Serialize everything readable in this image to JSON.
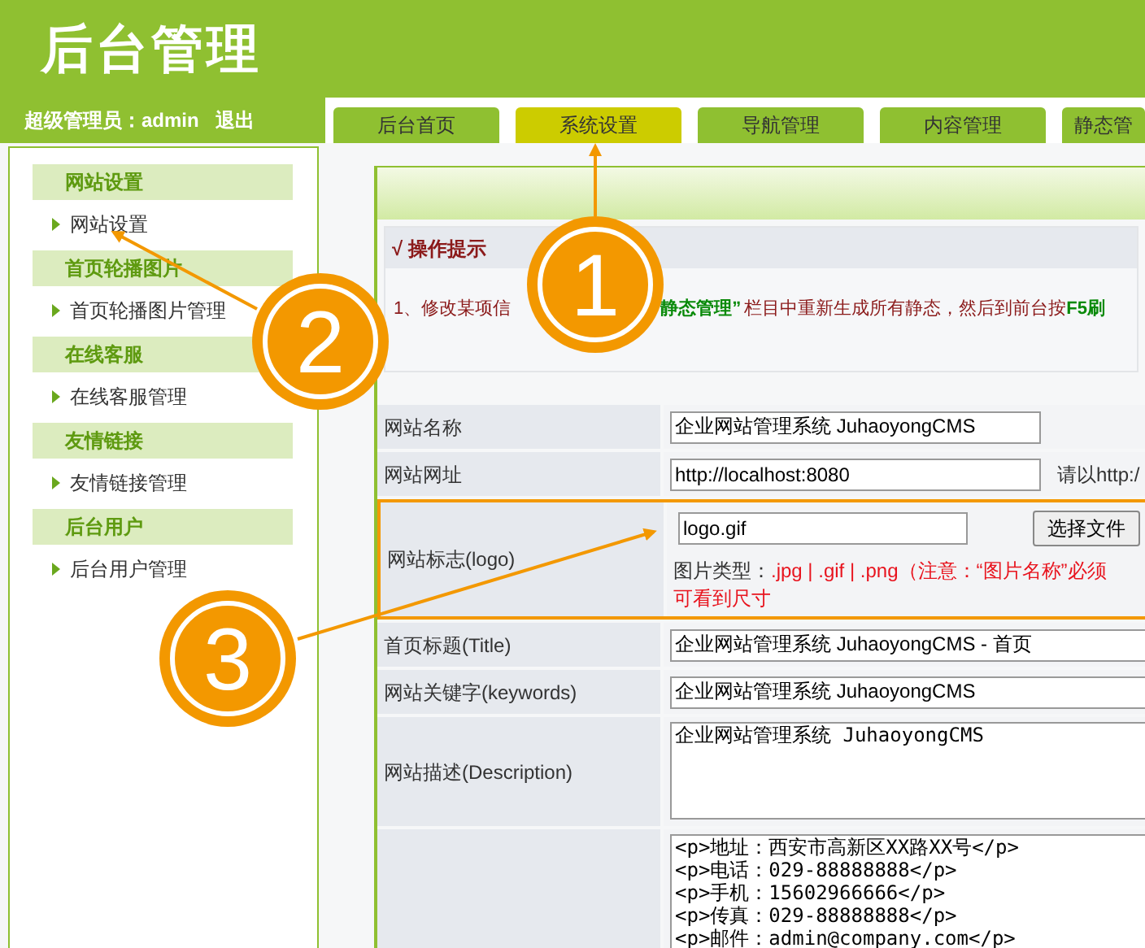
{
  "header": {
    "title": "后台管理",
    "user_label": "超级管理员：admin",
    "logout": "退出"
  },
  "tabs": [
    {
      "label": "后台首页",
      "selected": false
    },
    {
      "label": "系统设置",
      "selected": true
    },
    {
      "label": "导航管理",
      "selected": false
    },
    {
      "label": "内容管理",
      "selected": false
    },
    {
      "label": "静态管",
      "selected": false
    }
  ],
  "sidebar": [
    {
      "title": "网站设置",
      "items": [
        "网站设置"
      ]
    },
    {
      "title": "首页轮播图片",
      "items": [
        "首页轮播图片管理"
      ]
    },
    {
      "title": "在线客服",
      "items": [
        "在线客服管理"
      ]
    },
    {
      "title": "友情链接",
      "items": [
        "友情链接管理"
      ]
    },
    {
      "title": "后台用户",
      "items": [
        "后台用户管理"
      ]
    }
  ],
  "tip": {
    "title": "√ 操作提示",
    "parts": [
      {
        "text": "1、修改某项信",
        "kind": "plain"
      },
      {
        "text": "静态管理”",
        "kind": "emphasis"
      },
      {
        "text": "栏目中重新生成所有静态，然后到前台按",
        "kind": "plain"
      },
      {
        "text": "F5刷",
        "kind": "emphasis"
      }
    ]
  },
  "form": [
    {
      "kind": "input",
      "label": "网站名称",
      "value": "企业网站管理系统 JuhaoyongCMS"
    },
    {
      "kind": "input",
      "label": "网站网址",
      "value": "http://localhost:8080",
      "hint": "请以http:/"
    },
    {
      "kind": "logo",
      "label": "网站标志(logo)",
      "value": "logo.gif",
      "button": "选择文件",
      "note_label": "图片类型：",
      "note_line1": ".jpg | .gif | .png（注意：“图片名称”必须",
      "note_line2": "可看到尺寸",
      "highlighted": true
    },
    {
      "kind": "wide",
      "label": "首页标题(Title)",
      "value": "企业网站管理系统 JuhaoyongCMS - 首页"
    },
    {
      "kind": "wide",
      "label": "网站关键字(keywords)",
      "value": "企业网站管理系统 JuhaoyongCMS"
    },
    {
      "kind": "textarea",
      "label": "网站描述(Description)",
      "value": "企业网站管理系统 JuhaoyongCMS"
    },
    {
      "kind": "textarea",
      "value": "<p>地址：西安市高新区XX路XX号</p>\n<p>电话：029-88888888</p>\n<p>手机：15602966666</p>\n<p>传真：029-88888888</p>\n<p>邮件：admin@company.com</p>"
    }
  ],
  "annotations": [
    "1",
    "2",
    "3"
  ]
}
